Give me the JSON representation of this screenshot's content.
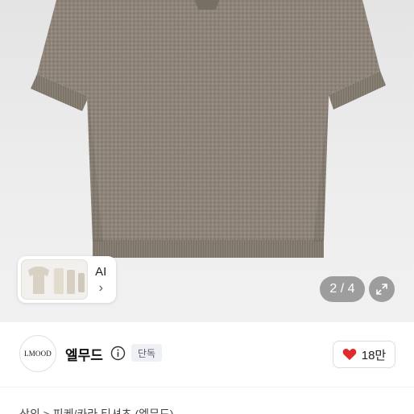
{
  "gallery": {
    "page_indicator": "2 / 4",
    "ai_chip": {
      "label": "AI",
      "chevron": "›"
    },
    "expand_icon": "expand-arrows-icon"
  },
  "seller": {
    "logo_text": "LMOOD",
    "name": "엘무드",
    "badge": "단독",
    "info_icon": "info-circle-icon"
  },
  "like": {
    "count": "18만",
    "icon": "heart-icon",
    "color": "#e02a2a"
  },
  "breadcrumb": {
    "text": "상의 > 피케/카라 티셔츠 (엘무드)"
  },
  "colors": {
    "shirt": "#8e8479",
    "background": "#ececec"
  }
}
